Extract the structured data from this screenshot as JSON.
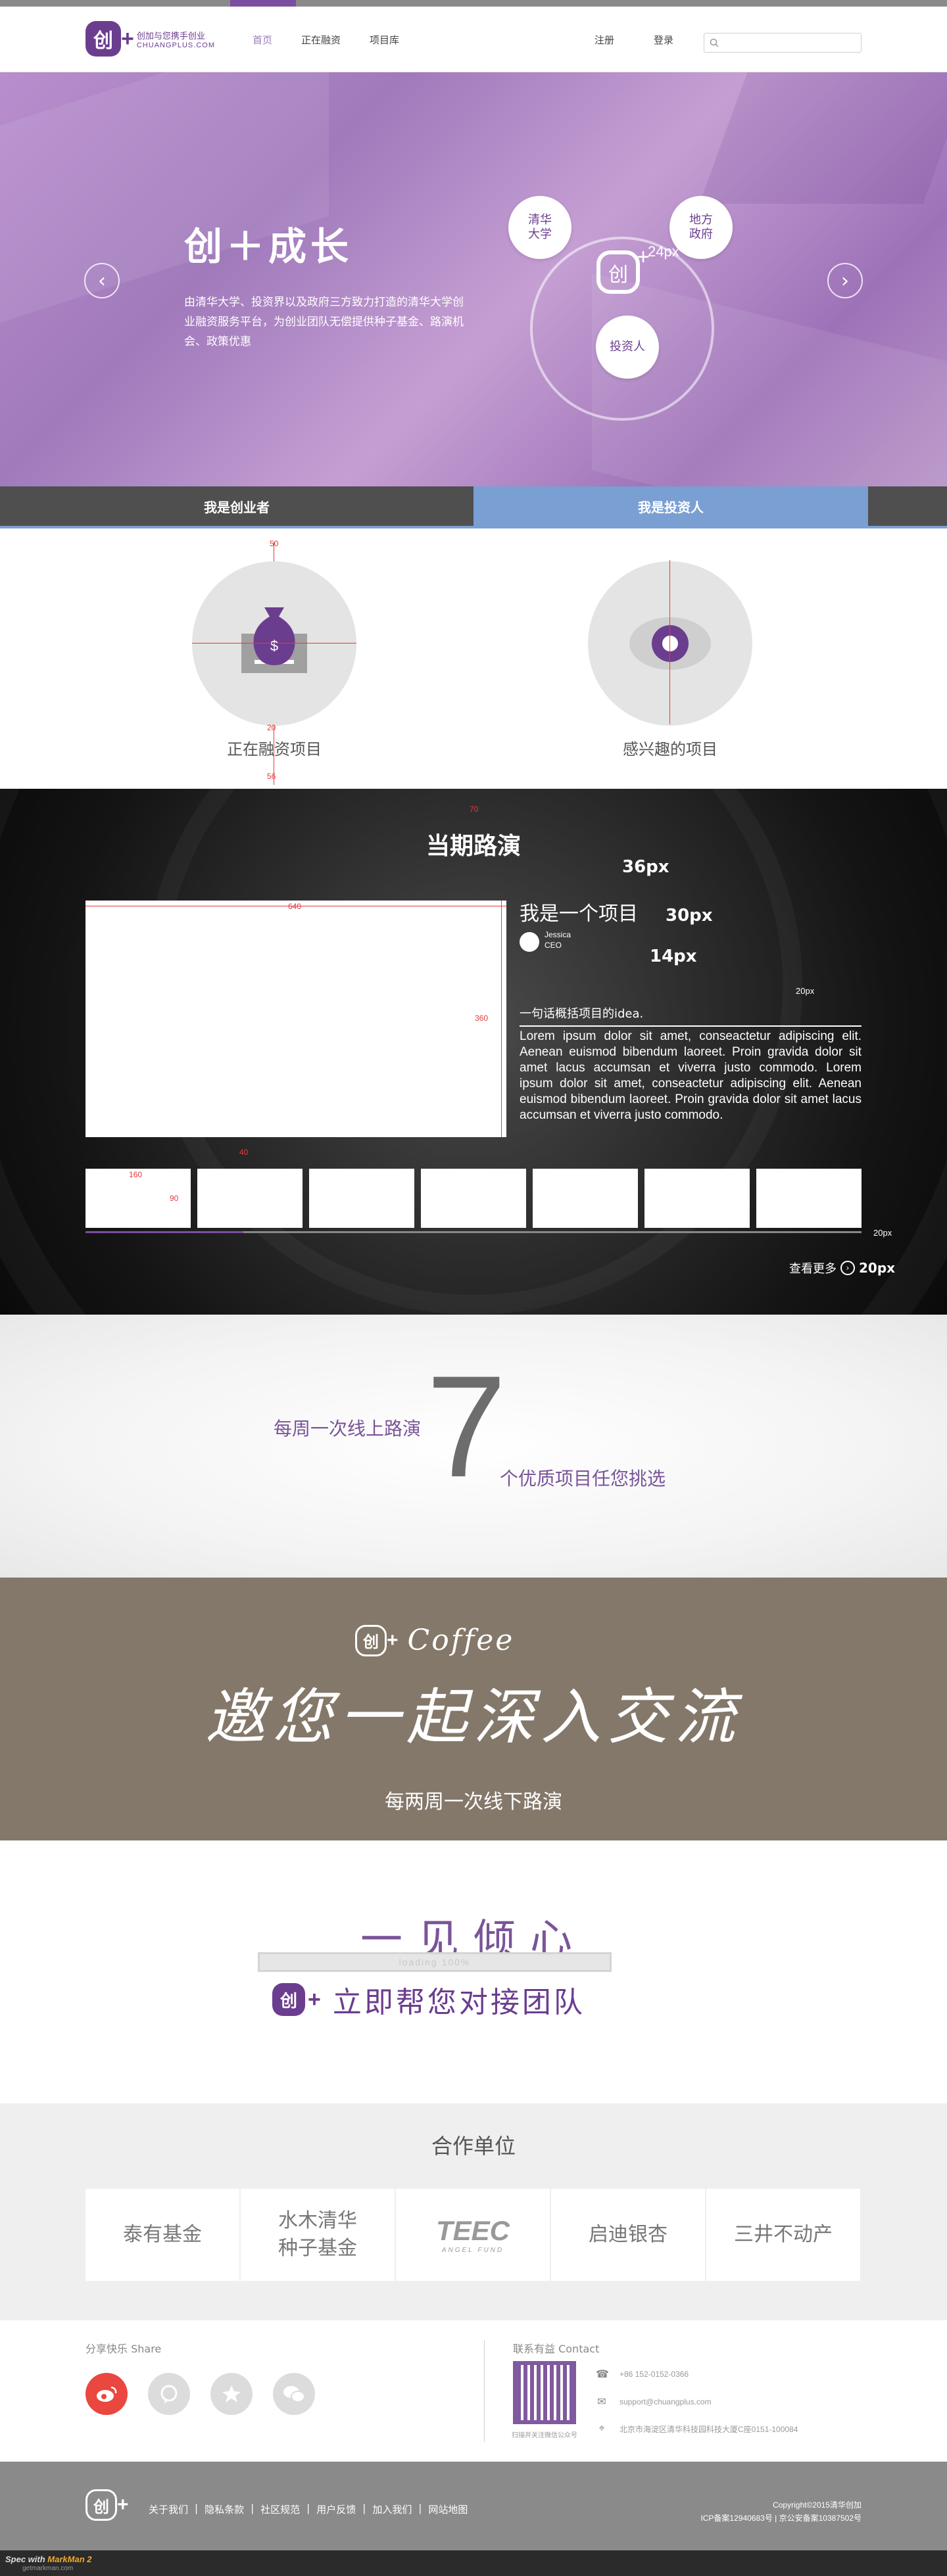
{
  "header": {
    "logo_char": "创",
    "logo_plus": "+",
    "logo_line1": "创加与您携手创业",
    "logo_line2": "CHUANGPLUS.COM",
    "nav": [
      "首页",
      "正在融资",
      "项目库"
    ],
    "auth": [
      "注册",
      "登录"
    ],
    "search_placeholder": ""
  },
  "hero": {
    "title": "创＋成长",
    "description": "由清华大学、投资界以及政府三方致力打造的清华大学创业融资服务平台，为创业团队无偿提供种子基金、路演机会、政策优惠",
    "bubbles": [
      "清华\n大学",
      "地方\n政府",
      "投资人"
    ],
    "annotation": "24px",
    "prev_icon": "‹",
    "next_icon": "›"
  },
  "roles": {
    "tabs": [
      "我是创业者",
      "我是投资人"
    ],
    "items": [
      "正在融资项目",
      "感兴趣的项目"
    ],
    "annotations": [
      "50",
      "20",
      "56"
    ]
  },
  "roadshow": {
    "title": "当期路演",
    "project_title": "我是一个项目",
    "person_name": "Jessica",
    "person_role": "CEO",
    "tagline": "一句话概括项目的idea.",
    "body": "Lorem ipsum dolor sit amet, conseactetur adipiscing elit. Aenean euismod bibendum laoreet. Proin gravida dolor sit amet lacus accumsan et viverra justo commodo. Lorem ipsum dolor sit amet, conseactetur adipiscing elit. Aenean euismod bibendum laoreet. Proin gravida dolor sit amet lacus accumsan et viverra justo commodo.",
    "size_hints": [
      "36px",
      "30px",
      "14px",
      "20px",
      "20px",
      "20px"
    ],
    "dims": [
      "640",
      "360",
      "160",
      "90",
      "40",
      "70"
    ],
    "more": "查看更多",
    "more_icon": "›"
  },
  "weekly": {
    "left": "每周一次线上路演",
    "number": "7",
    "right": "个优质项目任您挑选"
  },
  "coffee": {
    "word": "Coffee",
    "script": "邀您一起深入交流",
    "sub": "每两周一次线下路演"
  },
  "love": {
    "heading": "一见倾心",
    "bar_text": "loading 100%",
    "cta": "立即帮您对接团队"
  },
  "partners": {
    "title": "合作单位",
    "logos": [
      "泰有基金",
      "水木清华\n种子基金",
      "TEEC",
      "启迪银杏",
      "三井不动产"
    ],
    "teec_sub": "ANGEL FUND"
  },
  "share": {
    "label": "分享快乐 Share",
    "icons": [
      "weibo-icon",
      "chat-bubble-icon",
      "star-icon",
      "wechat-icon"
    ],
    "colors": [
      "#e9473f",
      "#dcdcdc",
      "#dcdcdc",
      "#dcdcdc"
    ]
  },
  "contact": {
    "label": "联系有益 Contact",
    "phone": "+86 152-0152-0366",
    "email": "support@chuangplus.com",
    "address": "北京市海淀区清华科技园科技大厦C座0151-100084",
    "qr_caption": "扫描并关注微信公众号"
  },
  "footer": {
    "links": [
      "关于我们",
      "|",
      "隐私条款",
      "|",
      "社区规范",
      "|",
      "用户反馈",
      "|",
      "加入我们",
      "|",
      "网站地图"
    ],
    "copyright": "Copyright©2015清华创加",
    "icp": "ICP备案12940683号 | 京公安备案10387502号"
  },
  "tool": {
    "brand": "Spec with ",
    "brand_strong": "MarkMan 2",
    "url": "getmarkman.com"
  },
  "colors": {
    "purple": "#6b3d8f",
    "hero": "#b18ac6",
    "tab_active": "#7a9fd2",
    "coffee_bg": "#84786a"
  }
}
